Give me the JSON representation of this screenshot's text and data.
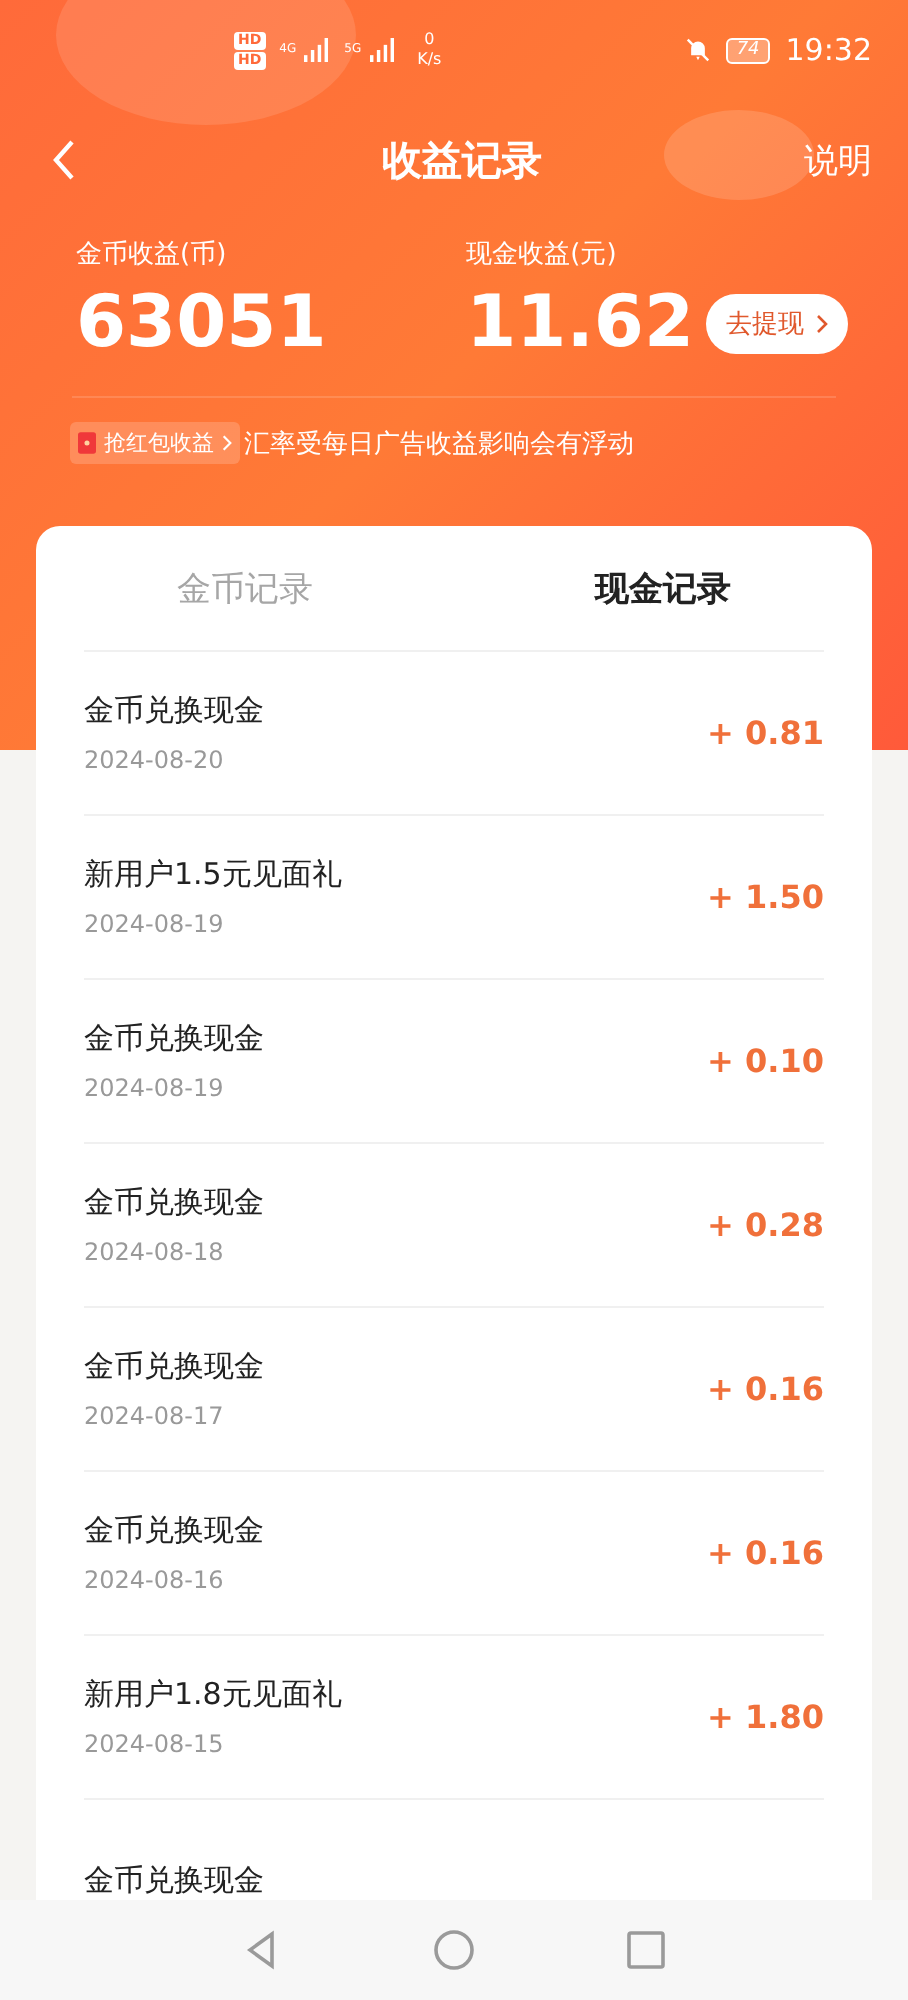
{
  "status_bar": {
    "hd_badges": [
      "HD",
      "HD"
    ],
    "networks": [
      "4G",
      "5G"
    ],
    "speed_value": "0",
    "speed_unit": "K/s",
    "battery": "74",
    "time": "19:32"
  },
  "header": {
    "title": "收益记录",
    "action": "说明"
  },
  "summary": [
    {
      "label": "金币收益(币)",
      "value": "63051"
    },
    {
      "label": "现金收益(元)",
      "value": "11.62",
      "button": "去提现"
    }
  ],
  "notice": {
    "tag": "抢红包收益",
    "text": "汇率受每日广告收益影响会有浮动"
  },
  "tabs": [
    {
      "label": "金币记录",
      "selected": false
    },
    {
      "label": "现金记录",
      "selected": true
    }
  ],
  "records": [
    {
      "title": "金币兑换现金",
      "date": "2024-08-20",
      "amount": "+ 0.81"
    },
    {
      "title": "新用户1.5元见面礼",
      "date": "2024-08-19",
      "amount": "+ 1.50"
    },
    {
      "title": "金币兑换现金",
      "date": "2024-08-19",
      "amount": "+ 0.10"
    },
    {
      "title": "金币兑换现金",
      "date": "2024-08-18",
      "amount": "+ 0.28"
    },
    {
      "title": "金币兑换现金",
      "date": "2024-08-17",
      "amount": "+ 0.16"
    },
    {
      "title": "金币兑换现金",
      "date": "2024-08-16",
      "amount": "+ 0.16"
    },
    {
      "title": "新用户1.8元见面礼",
      "date": "2024-08-15",
      "amount": "+ 1.80"
    },
    {
      "title": "金币兑换现金"
    }
  ]
}
